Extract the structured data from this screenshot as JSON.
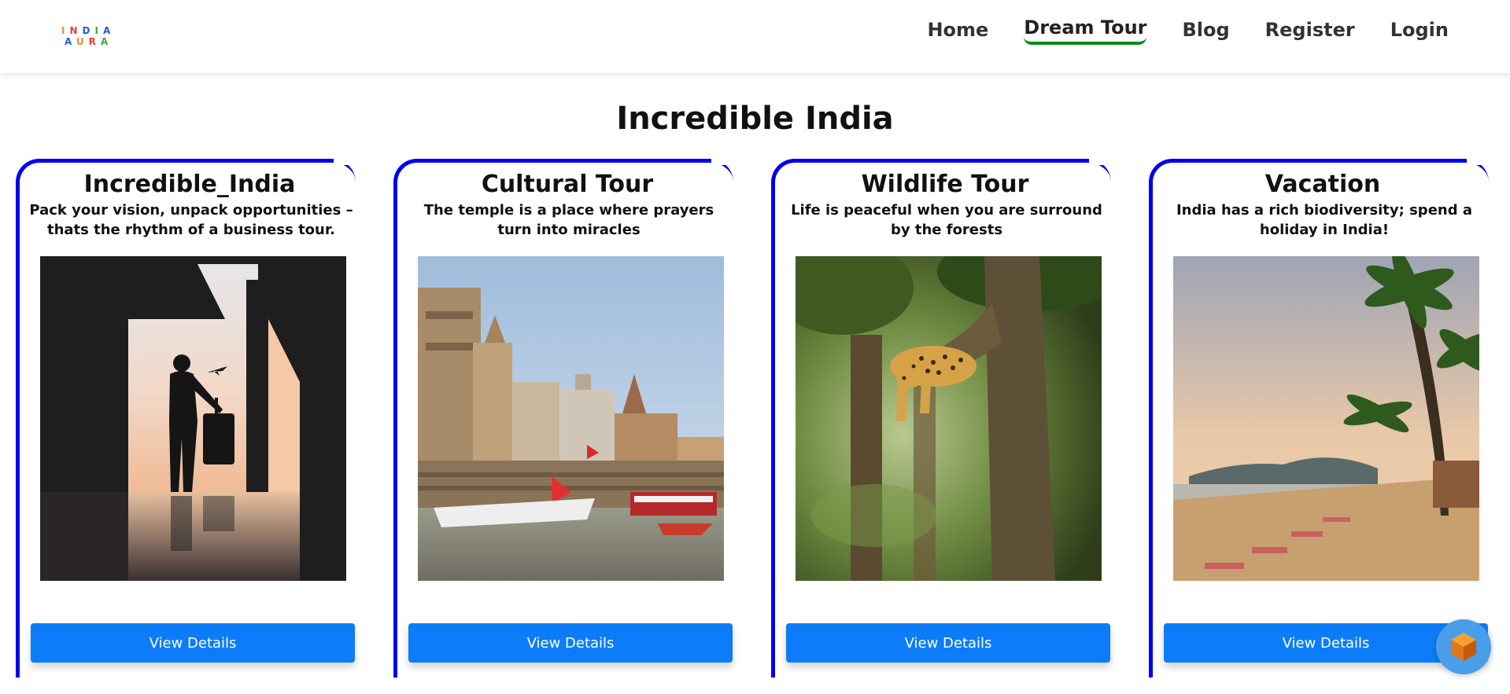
{
  "brand": {
    "logo_row1": "INDIA",
    "logo_row2": "AURA"
  },
  "nav": {
    "items": [
      {
        "label": "Home"
      },
      {
        "label": "Dream Tour",
        "active": true
      },
      {
        "label": "Blog"
      },
      {
        "label": "Register"
      },
      {
        "label": "Login"
      }
    ],
    "active_underline_color": "#0a8a1a"
  },
  "main": {
    "title": "Incredible India"
  },
  "cards": [
    {
      "title": "Incredible_India",
      "description": "Pack your vision, unpack opportunities – thats the rhythm of a business tour.",
      "image_alt": "traveler-silhouette-airport",
      "button": "View Details"
    },
    {
      "title": "Cultural Tour",
      "description": "The temple is a place where prayers turn into miracles",
      "image_alt": "varanasi-ghats-boats",
      "button": "View Details"
    },
    {
      "title": "Wildlife Tour",
      "description": "Life is peaceful when you are surround by the forests",
      "image_alt": "leopard-on-tree",
      "button": "View Details"
    },
    {
      "title": "Vacation",
      "description": "India has a rich biodiversity; spend a holiday in India!",
      "image_alt": "palm-beach-sunset",
      "button": "View Details"
    }
  ],
  "colors": {
    "card_border": "#0000ee",
    "button_bg": "#0d7cf8",
    "fab_bg": "#4a9de8"
  }
}
